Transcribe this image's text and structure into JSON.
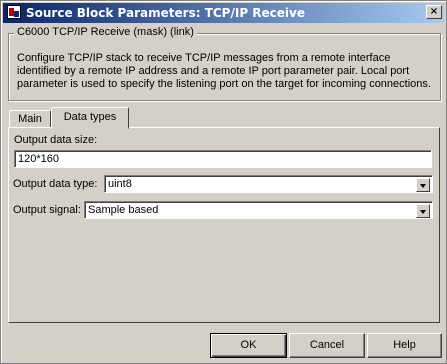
{
  "window": {
    "title": "Source Block Parameters: TCP/IP Receive",
    "close_glyph": "×"
  },
  "group": {
    "title": "C6000 TCP/IP Receive (mask) (link)",
    "description": "Configure TCP/IP stack  to receive TCP/IP messages from a remote interface identified by a remote  IP address and a remote IP port parameter pair. Local port parameter is used to specify the listening port on the target for incoming connections."
  },
  "tabs": [
    {
      "label": "Main",
      "selected": false
    },
    {
      "label": "Data types",
      "selected": true
    }
  ],
  "form": {
    "output_data_size": {
      "label": "Output data size:",
      "value": "120*160"
    },
    "output_data_type": {
      "label": "Output data type:",
      "value": "uint8"
    },
    "output_signal": {
      "label": "Output signal:",
      "value": "Sample based"
    }
  },
  "buttons": {
    "ok": "OK",
    "cancel": "Cancel",
    "help": "Help"
  },
  "colors": {
    "titlebar_start": "#0a246a",
    "titlebar_end": "#a6caf0",
    "dialog_face": "#d4d0c8"
  },
  "icons": {
    "app": "simulink-block-icon",
    "dropdown": "chevron-down-icon"
  }
}
